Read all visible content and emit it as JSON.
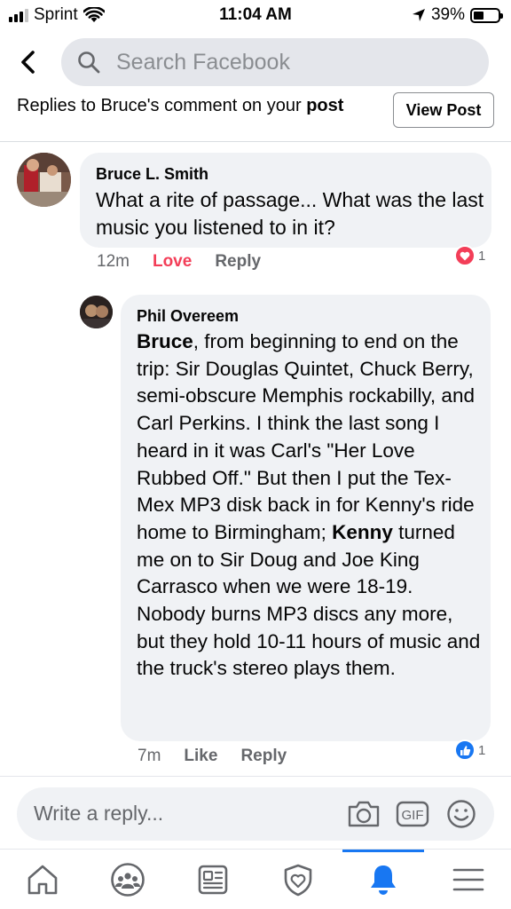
{
  "status_bar": {
    "carrier": "Sprint",
    "time": "11:04 AM",
    "battery": "39%"
  },
  "header": {
    "search_placeholder": "Search Facebook"
  },
  "replies_bar": {
    "prefix": "Replies to Bruce's comment on your ",
    "bold": "post",
    "view_post": "View Post"
  },
  "comments": {
    "bruce": {
      "author": "Bruce L. Smith",
      "text": "What a rite of passage... What was the last music you listened to in it?",
      "time": "12m",
      "reaction_action": "Love",
      "reply": "Reply",
      "reaction_count": "1",
      "reaction_type": "love"
    },
    "phil": {
      "author": "Phil Overeem",
      "mention1": "Bruce",
      "text1": ", from beginning to end on the trip: Sir Douglas Quintet, Chuck Berry, semi-obscure Memphis rockabilly, and Carl Perkins. I think the last song I heard in it was Carl's \"Her Love Rubbed Off.\" But then I put the Tex-Mex MP3 disk back in for Kenny's ride home to Birmingham; ",
      "mention2": "Kenny",
      "text2": " turned me on to Sir Doug and Joe King Carrasco when we were 18-19. Nobody burns MP3 discs any more, but they hold 10-11 hours of music and the truck's stereo plays them.",
      "time": "7m",
      "like": "Like",
      "reply": "Reply",
      "reaction_count": "1",
      "reaction_type": "like"
    }
  },
  "composer": {
    "placeholder": "Write a reply...",
    "gif_label": "GIF"
  },
  "bottom_nav": {
    "items": [
      "home",
      "groups",
      "news",
      "shield",
      "notifications",
      "menu"
    ],
    "active": "notifications"
  },
  "colors": {
    "accent": "#1877f2",
    "love": "#f33e58",
    "bubble": "#f0f2f5"
  }
}
